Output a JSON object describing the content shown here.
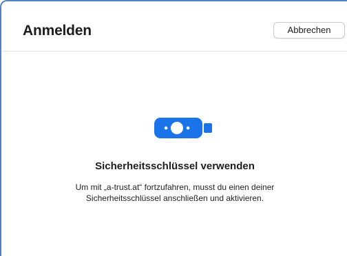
{
  "dialog": {
    "title": "Anmelden",
    "cancel_label": "Abbrechen"
  },
  "content": {
    "icon": "security-key-icon",
    "heading": "Sicherheitsschlüssel verwenden",
    "description": "Um mit „a-trust.at“ fortzufahren, musst du einen deiner Sicherheitsschlüssel anschließen und aktivieren."
  },
  "colors": {
    "accent": "#1a73e8",
    "window_border": "#4f82c9"
  }
}
